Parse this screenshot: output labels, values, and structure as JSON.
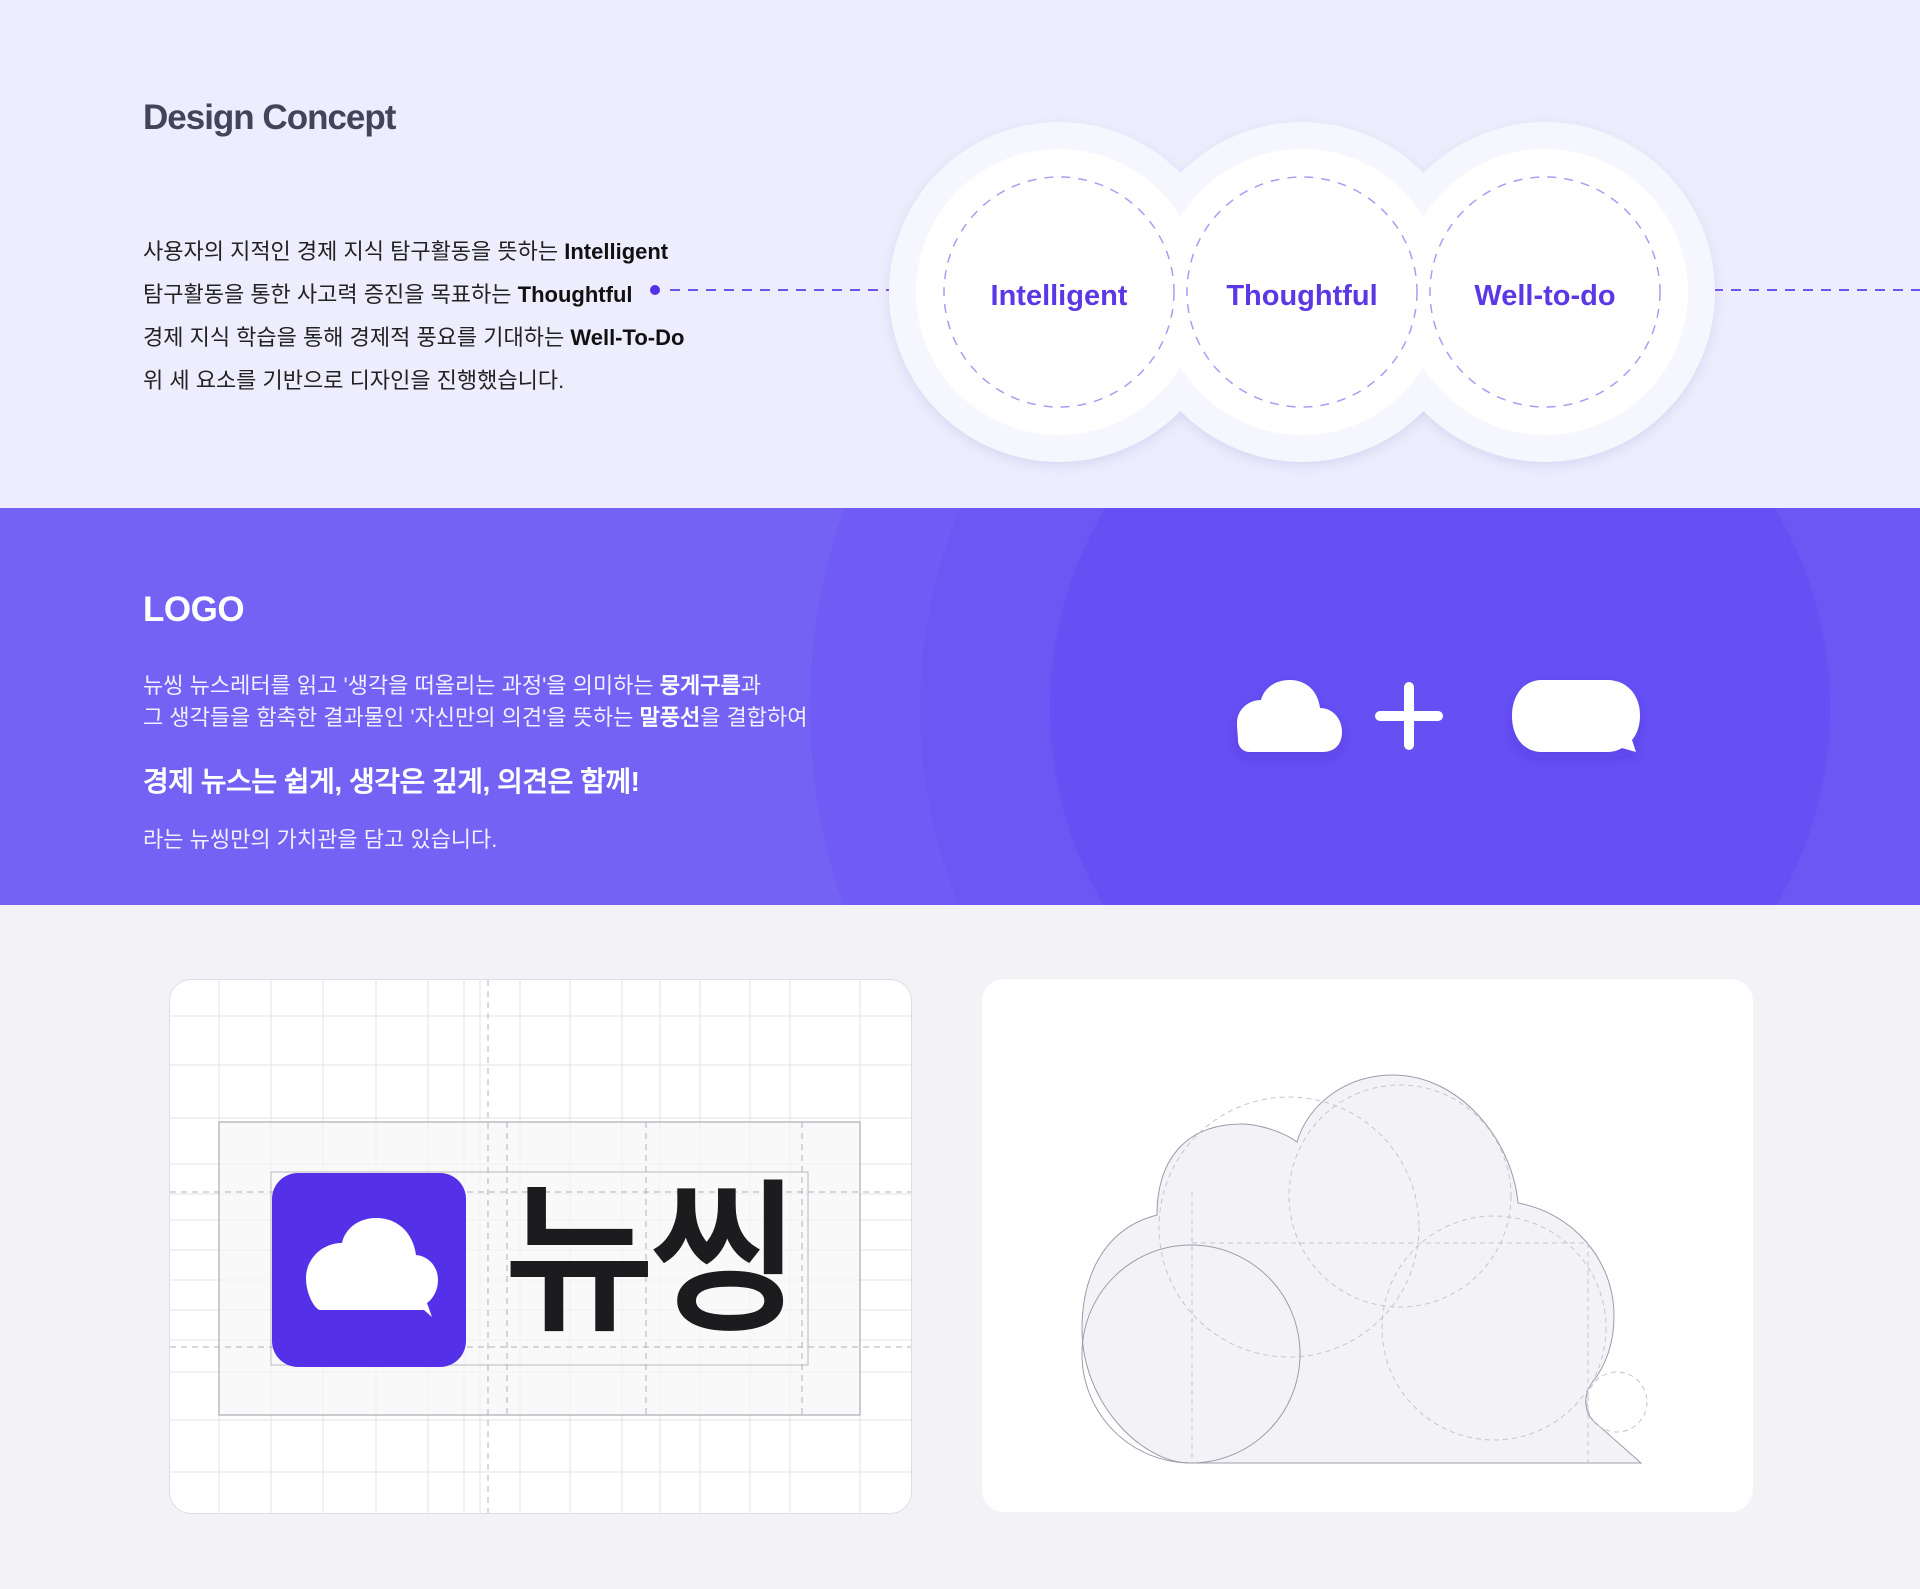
{
  "design_concept": {
    "title": "Design Concept",
    "lines": [
      {
        "text": "사용자의 지적인 경제 지식 탐구활동을 뜻하는 ",
        "bold": "Intelligent"
      },
      {
        "text": "탐구활동을 통한 사고력 증진을 목표하는 ",
        "bold": "Thoughtful"
      },
      {
        "text": "경제 지식 학습을 통해 경제적 풍요를 기대하는 ",
        "bold": "Well-To-Do"
      },
      {
        "text": "위 세 요소를 기반으로 디자인을 진행했습니다.",
        "bold": ""
      }
    ],
    "circles": [
      "Intelligent",
      "Thoughtful",
      "Well-to-do"
    ]
  },
  "logo": {
    "title": "LOGO",
    "line1": {
      "pre": "뉴씽 뉴스레터를 읽고 '생각을 떠올리는 과정'을 의미하는 ",
      "bold": "뭉게구름",
      "post": "과"
    },
    "line2": {
      "pre": "그 생각들을 함축한 결과물인 '자신만의 의견'을 뜻하는 ",
      "bold": "말풍선",
      "post": "을 결합하여"
    },
    "slogan": "경제 뉴스는 쉽게, 생각은 깊게, 의견은 함께!",
    "sub": "라는 뉴씽만의 가치관을 담고 있습니다."
  },
  "wordmark": "뉴씽",
  "colors": {
    "accent": "#5431e8",
    "concept_bg": "#eeedfd",
    "logo_bg": "#7462f4",
    "circle_text": "#5a38e6"
  }
}
